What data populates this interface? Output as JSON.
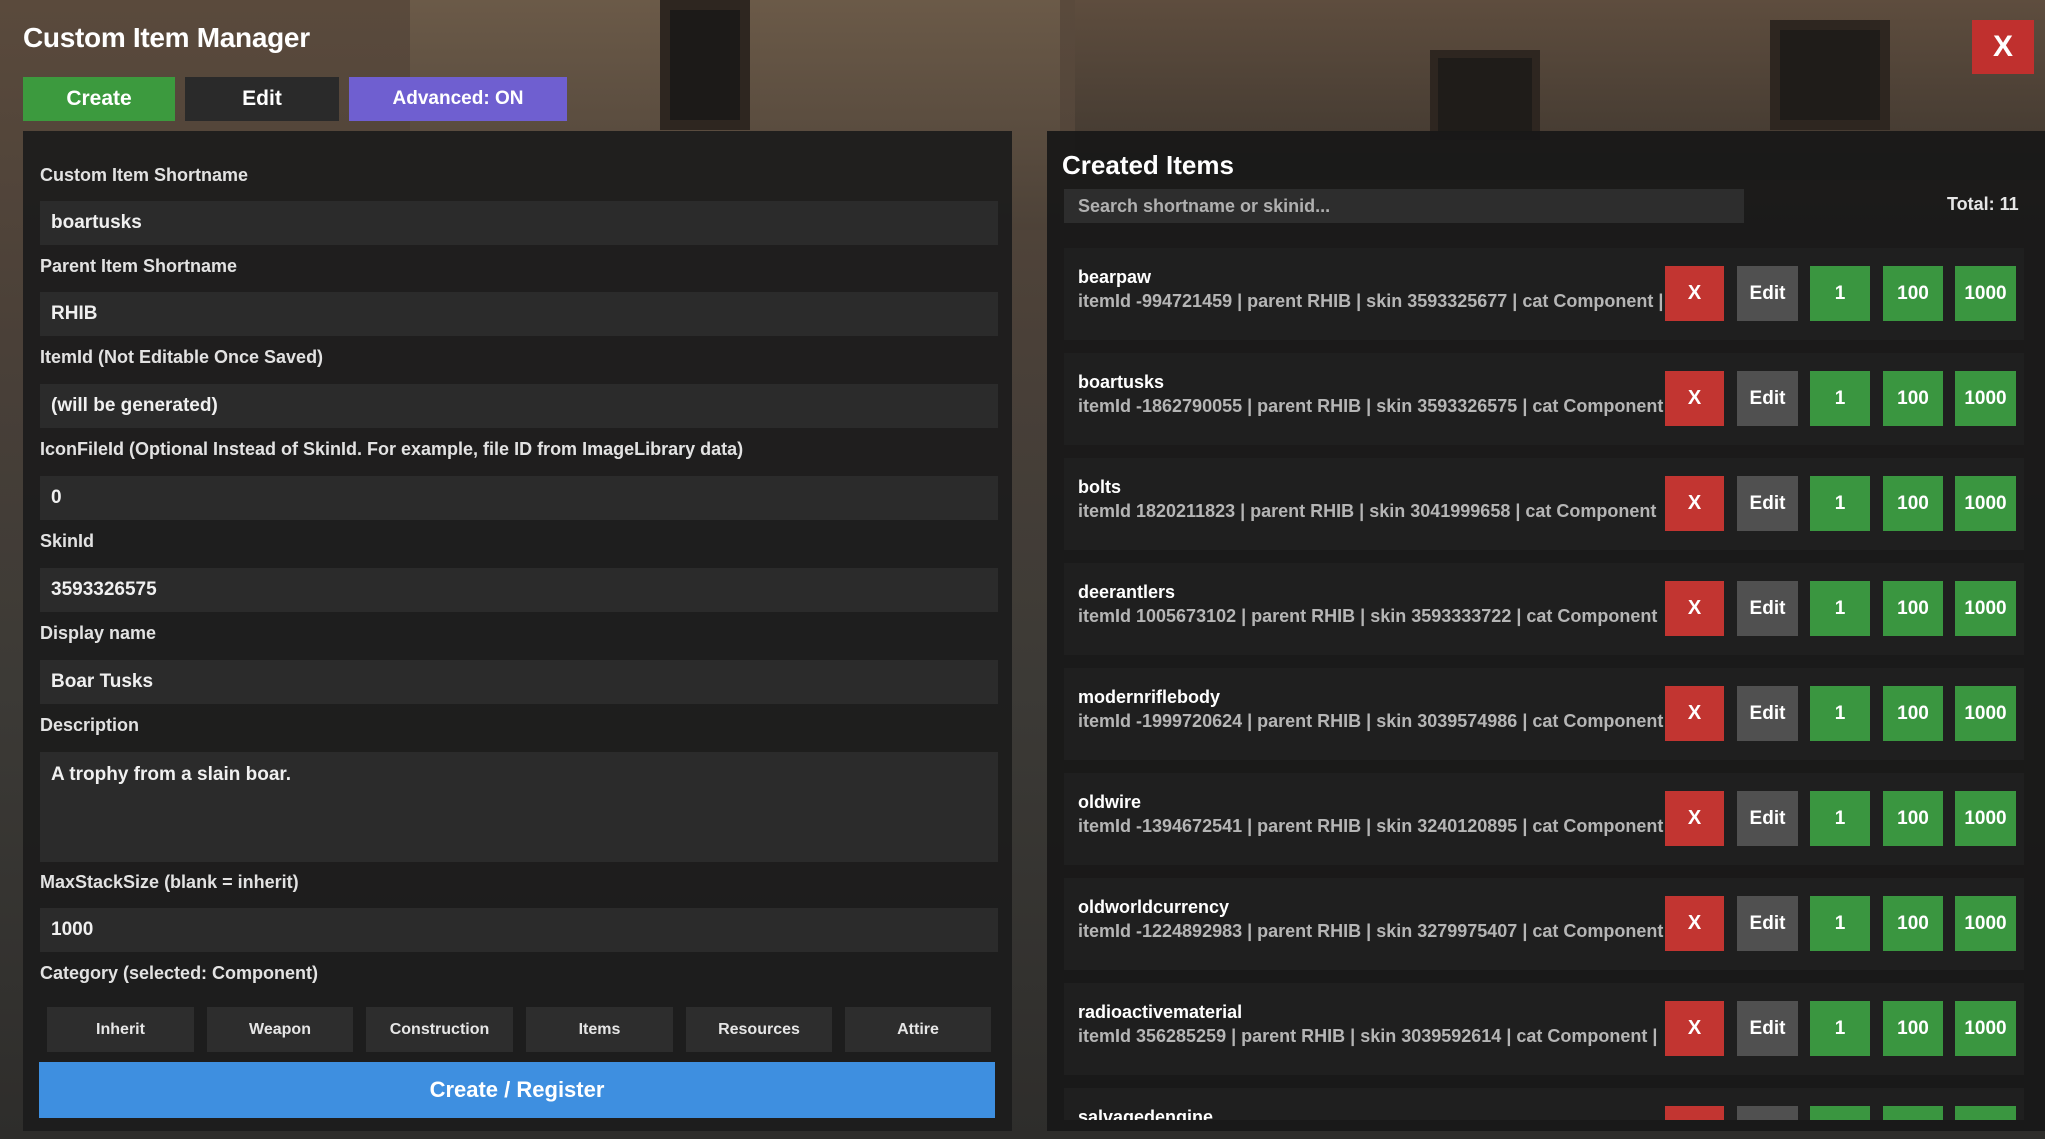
{
  "window": {
    "title": "Custom Item Manager",
    "close_label": "X"
  },
  "toolbar": {
    "create_label": "Create",
    "edit_label": "Edit",
    "advanced_label": "Advanced: ON"
  },
  "form": {
    "fields": [
      {
        "label": "Custom Item Shortname",
        "value": "boartusks"
      },
      {
        "label": "Parent Item Shortname",
        "value": "RHIB"
      },
      {
        "label": "ItemId (Not Editable Once Saved)",
        "value": "(will be generated)"
      },
      {
        "label": "IconFileId (Optional Instead of SkinId. For example, file ID from ImageLibrary data)",
        "value": "0"
      },
      {
        "label": "SkinId",
        "value": "3593326575"
      },
      {
        "label": "Display name",
        "value": "Boar Tusks"
      },
      {
        "label": "Description",
        "value": "A trophy from a slain boar."
      },
      {
        "label": "MaxStackSize (blank = inherit)",
        "value": "1000"
      }
    ],
    "category_label": "Category (selected: Component)",
    "categories": [
      "Inherit",
      "Weapon",
      "Construction",
      "Items",
      "Resources",
      "Attire"
    ],
    "submit_label": "Create / Register"
  },
  "created": {
    "title": "Created Items",
    "search_placeholder": "Search shortname or skinid...",
    "total_label": "Total: 11",
    "buttons": {
      "delete": "X",
      "edit": "Edit",
      "give1": "1",
      "give100": "100",
      "give1000": "1000"
    },
    "items": [
      {
        "name": "bearpaw",
        "meta": "itemId -994721459 | parent RHIB | skin 3593325677 | cat Component |"
      },
      {
        "name": "boartusks",
        "meta": "itemId -1862790055 | parent RHIB | skin 3593326575 | cat Component"
      },
      {
        "name": "bolts",
        "meta": "itemId 1820211823 | parent RHIB | skin 3041999658 | cat Component"
      },
      {
        "name": "deerantlers",
        "meta": "itemId 1005673102 | parent RHIB | skin 3593333722 | cat Component"
      },
      {
        "name": "modernriflebody",
        "meta": "itemId -1999720624 | parent RHIB | skin 3039574986 | cat Component"
      },
      {
        "name": "oldwire",
        "meta": "itemId -1394672541 | parent RHIB | skin 3240120895 | cat Component"
      },
      {
        "name": "oldworldcurrency",
        "meta": "itemId -1224892983 | parent RHIB | skin 3279975407 | cat Component"
      },
      {
        "name": "radioactivematerial",
        "meta": "itemId 356285259 | parent RHIB | skin 3039592614 | cat Component |"
      },
      {
        "name": "salvagedengine",
        "meta": ""
      }
    ]
  }
}
